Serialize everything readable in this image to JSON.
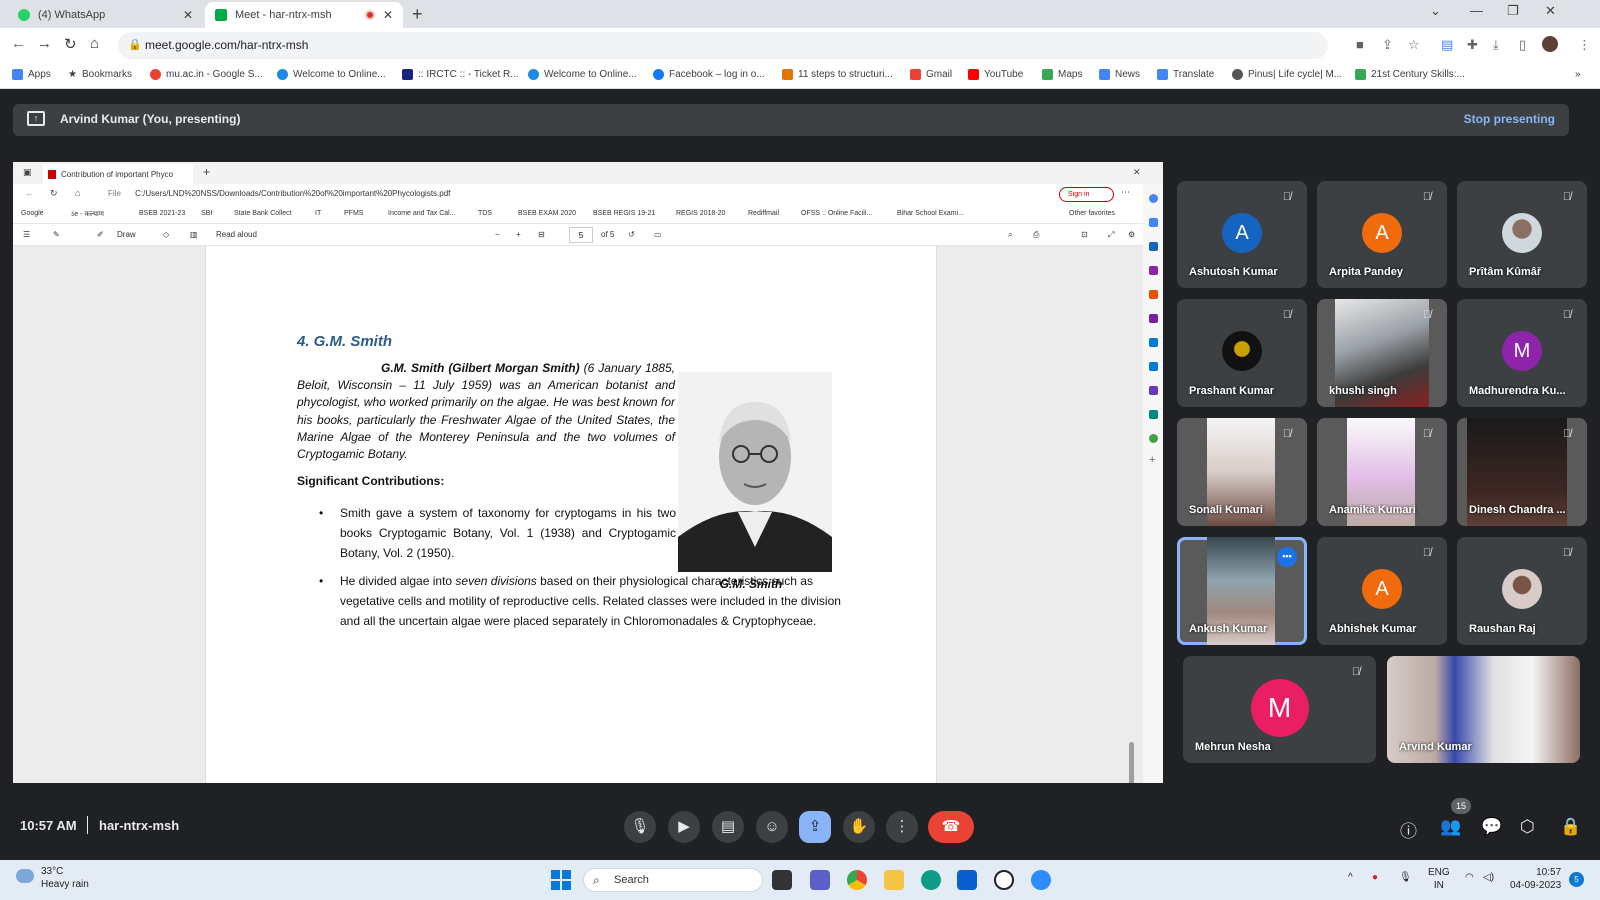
{
  "browser": {
    "tabs": [
      {
        "title": "(4) WhatsApp"
      },
      {
        "title": "Meet - har-ntrx-msh"
      }
    ],
    "url": "meet.google.com/har-ntrx-msh",
    "bookmarks": [
      "Apps",
      "Bookmarks",
      "mu.ac.in - Google S...",
      "Welcome to Online...",
      ":: IRCTC :: - Ticket R...",
      "Welcome to Online...",
      "Facebook – log in o...",
      "11 steps to structuri...",
      "Gmail",
      "YouTube",
      "Maps",
      "News",
      "Translate",
      "Pinus| Life cycle| M...",
      "21st Century Skills:..."
    ]
  },
  "meet": {
    "presenter_label": "Arvind Kumar (You, presenting)",
    "stop_label": "Stop presenting",
    "time": "10:57 AM",
    "meeting_code": "har-ntrx-msh",
    "people_count": "15",
    "participants": [
      {
        "name": "Ashutosh Kumar",
        "initial": "A",
        "color": "#1565c0"
      },
      {
        "name": "Arpita Pandey",
        "initial": "A",
        "color": "#f06b0c"
      },
      {
        "name": "Prȋtâm Kûmâř",
        "initial": "",
        "color": "#cfd8dc"
      },
      {
        "name": "Prashant Kumar",
        "initial": "",
        "color": "#2b2b2b"
      },
      {
        "name": "khushi singh",
        "initial": "",
        "color": ""
      },
      {
        "name": "Madhurendra Ku...",
        "initial": "M",
        "color": "#8e24aa"
      },
      {
        "name": "Sonali Kumari",
        "initial": "",
        "color": ""
      },
      {
        "name": "Anamika Kumari",
        "initial": "",
        "color": ""
      },
      {
        "name": "Dinesh Chandra ...",
        "initial": "",
        "color": ""
      },
      {
        "name": "Ankush Kumar",
        "initial": "",
        "color": ""
      },
      {
        "name": "Abhishek Kumar",
        "initial": "A",
        "color": "#f06b0c"
      },
      {
        "name": "Raushan Raj",
        "initial": "",
        "color": "#d7ccc8"
      },
      {
        "name": "Mehrun Nesha",
        "initial": "M",
        "color": "#e91e63"
      },
      {
        "name": "Arvind Kumar",
        "initial": "",
        "color": ""
      }
    ]
  },
  "shared": {
    "tab_title": "Contribution of important Phyco",
    "file_label": "File",
    "path": "C:/Users/LND%20NSS/Downloads/Contribution%20of%20important%20Phycologists.pdf",
    "sign_in": "Sign in",
    "bookmarks": [
      "Google",
      "ऽe - कल्याण",
      "BSEB 2021-23",
      "SBI",
      "State Bank Collect",
      "IT",
      "PFMS",
      "Income and Tax Cal...",
      "TDS",
      "BSEB EXAM 2020",
      "BSEB REGIS 19-21",
      "REGIS 2018-20",
      "Rediffmail",
      "OFSS :: Online Facili...",
      "Bihar School Exami...",
      "Other favorites"
    ],
    "pdf_tools": {
      "draw": "Draw",
      "read_aloud": "Read aloud",
      "page": "5",
      "of": "of 5"
    },
    "doc": {
      "heading": "4. G.M. Smith",
      "para_bold": "G.M. Smith (Gilbert Morgan Smith)",
      "para_rest": " (6 January 1885, Beloit, Wisconsin – 11 July 1959) was an American botanist and phycologist, who worked primarily on the algae. He was best known for his books, particularly the Freshwater Algae of the United States, the Marine Algae of the Monterey Peninsula and the two volumes of Cryptogamic Botany.",
      "sig_heading": "Significant Contributions:",
      "bullet1": "Smith gave a system of taxonomy for cryptogams in his two books Cryptogamic Botany, Vol. 1 (1938) and Cryptogamic Botany, Vol. 2 (1950).",
      "bullet2_a": "He divided algae into ",
      "bullet2_i": "seven divisions",
      "bullet2_b": " based on their physiological characteristics such as vegetative cells and motility of reproductive cells. Related classes were included in the division and all the uncertain algae were placed separately in Chloromonadales & Cryptophyceae.",
      "caption": "G.M. Smith"
    }
  },
  "taskbar": {
    "temp": "33°C",
    "weather": "Heavy rain",
    "search": "Search",
    "lang1": "ENG",
    "lang2": "IN",
    "clock_time": "10:57",
    "clock_date": "04-09-2023",
    "notif": "5"
  }
}
